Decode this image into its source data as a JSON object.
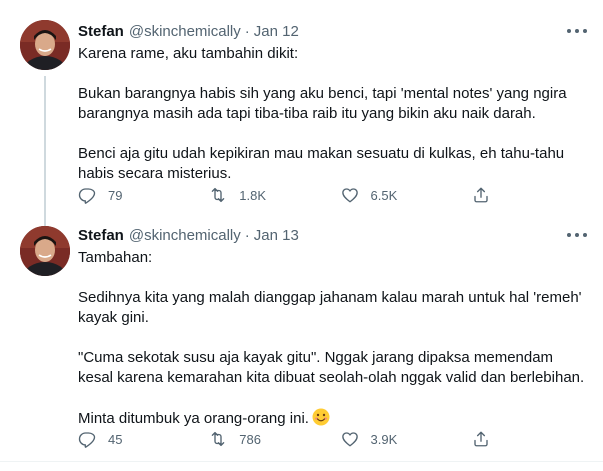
{
  "tweets": [
    {
      "author_name": "Stefan",
      "handle": "@skinchemically",
      "separator": "·",
      "date": "Jan 12",
      "paragraphs": [
        "Karena rame, aku tambahin dikit:",
        "Bukan barangnya habis sih yang aku benci, tapi 'mental notes' yang ngira barangnya masih ada tapi tiba-tiba raib itu yang bikin aku naik darah.",
        "Benci aja gitu udah kepikiran mau makan sesuatu di kulkas, eh tahu-tahu habis secara misterius."
      ],
      "stats": {
        "replies": "79",
        "retweets": "1.8K",
        "likes": "6.5K"
      }
    },
    {
      "author_name": "Stefan",
      "handle": "@skinchemically",
      "separator": "·",
      "date": "Jan 13",
      "paragraphs": [
        "Tambahan:",
        "Sedihnya kita yang malah dianggap jahanam kalau marah untuk hal 'remeh' kayak gini.",
        "\"Cuma sekotak susu aja kayak gitu\". Nggak jarang dipaksa memendam kesal karena kemarahan kita dibuat seolah-olah nggak valid dan berlebihan.",
        "Minta ditumbuk ya orang-orang ini."
      ],
      "stats": {
        "replies": "45",
        "retweets": "786",
        "likes": "3.9K"
      }
    }
  ],
  "icons": {
    "reply": "reply-icon",
    "retweet": "retweet-icon",
    "like": "heart-icon",
    "share": "share-icon",
    "more": "more-options-icon",
    "emoji": "smiling-face-emoji"
  },
  "colors": {
    "text": "#0f1419",
    "secondary": "#536471",
    "thread_line": "#cfd9de",
    "background": "#ffffff"
  }
}
